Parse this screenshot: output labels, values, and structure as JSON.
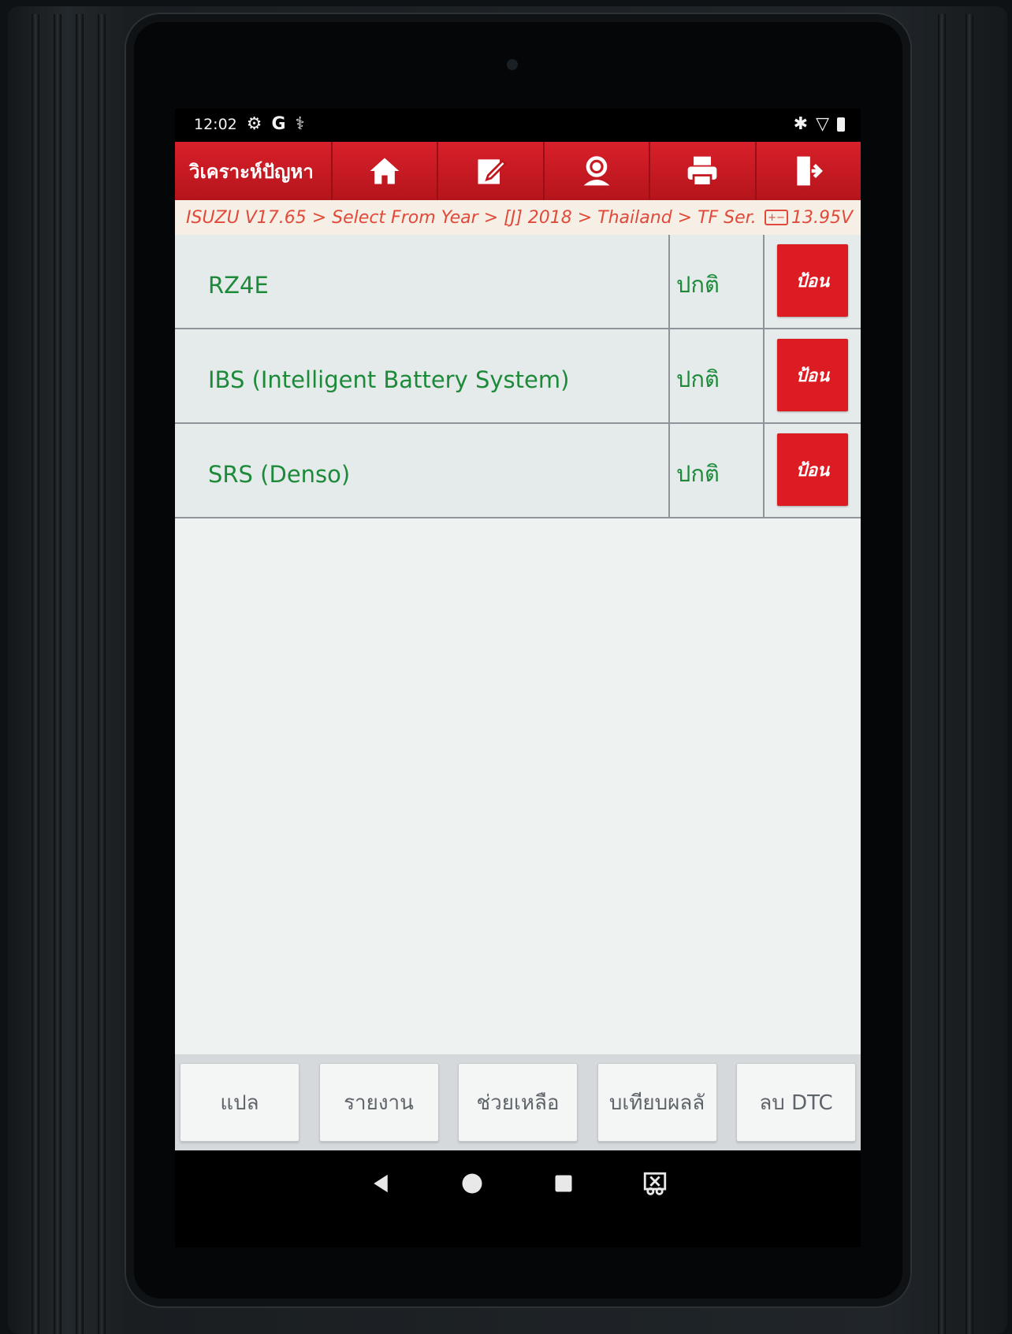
{
  "status_bar": {
    "time": "12:02",
    "left_icons": [
      "settings-gear-icon",
      "google-g-icon",
      "stethoscope-icon"
    ],
    "right_icons": [
      "bluetooth-icon",
      "wifi-icon",
      "battery-icon"
    ]
  },
  "toolbar": {
    "title": "วิเคราะห์ปัญหา",
    "buttons": [
      {
        "name": "home",
        "icon": "home-icon"
      },
      {
        "name": "edit",
        "icon": "edit-icon"
      },
      {
        "name": "support",
        "icon": "user-support-icon"
      },
      {
        "name": "print",
        "icon": "printer-icon"
      },
      {
        "name": "exit",
        "icon": "exit-icon"
      }
    ],
    "color": "#d21e27"
  },
  "breadcrumb": {
    "path": "ISUZU V17.65 > Select From Year > [J] 2018 > Thailand > TF Ser...",
    "voltage": "13.95V",
    "color": "#e14a3a"
  },
  "systems": [
    {
      "name": "RZ4E",
      "status": "ปกติ",
      "action": "ป้อน"
    },
    {
      "name": "IBS (Intelligent Battery System)",
      "status": "ปกติ",
      "action": "ป้อน"
    },
    {
      "name": "SRS (Denso)",
      "status": "ปกติ",
      "action": "ป้อน"
    }
  ],
  "bottom_buttons": [
    "แปล",
    "รายงาน",
    "ช่วยเหลือ",
    "บเทียบผลลั",
    "ลบ DTC"
  ],
  "navigation": [
    "back-icon",
    "home-circle-icon",
    "recents-icon",
    "screenshot-icon"
  ],
  "colors": {
    "accent_red": "#dc1b22",
    "ok_green": "#1d8a3a"
  }
}
